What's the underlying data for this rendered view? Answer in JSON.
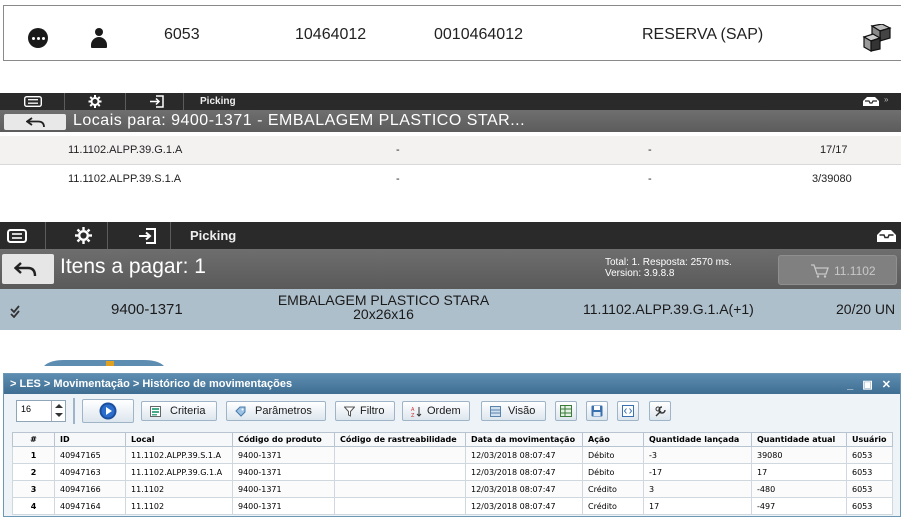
{
  "panel1": {
    "store": "6053",
    "document": "10464012",
    "document_full": "0010464012",
    "type": "RESERVA (SAP)"
  },
  "panel2": {
    "nav_title": "Picking",
    "header": "Locais para: 9400-1371 - EMBALAGEM PLASTICO STAR...",
    "rows": [
      {
        "location": "11.1102.ALPP.39.G.1.A",
        "c2": "-",
        "c3": "-",
        "qty": "17/17"
      },
      {
        "location": "11.1102.ALPP.39.S.1.A",
        "c2": "-",
        "c3": "-",
        "qty": "3/39080"
      }
    ]
  },
  "panel3": {
    "nav_title": "Picking",
    "header": "Itens a pagar: 1",
    "meta_total": "Total: 1. Resposta: 2570 ms.",
    "meta_version": "Version: 3.9.8.8",
    "cart_label": "11.1102",
    "item": {
      "code": "9400-1371",
      "desc_line1": "EMBALAGEM PLASTICO STARA",
      "desc_line2": "20x26x16",
      "location": "11.1102.ALPP.39.G.1.A(+1)",
      "qty": "20/20 UN"
    }
  },
  "panel4": {
    "breadcrumb": "> LES > Movimentação > Histórico de movimentações",
    "window_controls": "_ ▣ ✕",
    "page_size": "16",
    "buttons": {
      "criteria": "Criteria",
      "params": "Parâmetros",
      "filter": "Filtro",
      "order": "Ordem",
      "view": "Visão"
    },
    "columns": [
      "#",
      "ID",
      "Local",
      "Código do produto",
      "Código de rastreabilidade",
      "Data da movimentação",
      "Ação",
      "Quantidade lançada",
      "Quantidade atual",
      "Usuário"
    ],
    "rows": [
      [
        "1",
        "40947165",
        "11.1102.ALPP.39.S.1.A",
        "9400-1371",
        "",
        "12/03/2018 08:07:47",
        "Débito",
        "-3",
        "39080",
        "6053"
      ],
      [
        "2",
        "40947163",
        "11.1102.ALPP.39.G.1.A",
        "9400-1371",
        "",
        "12/03/2018 08:07:47",
        "Débito",
        "-17",
        "17",
        "6053"
      ],
      [
        "3",
        "40947166",
        "11.1102",
        "9400-1371",
        "",
        "12/03/2018 08:07:47",
        "Crédito",
        "3",
        "-480",
        "6053"
      ],
      [
        "4",
        "40947164",
        "11.1102",
        "9400-1371",
        "",
        "12/03/2018 08:07:47",
        "Crédito",
        "17",
        "-497",
        "6053"
      ]
    ]
  }
}
